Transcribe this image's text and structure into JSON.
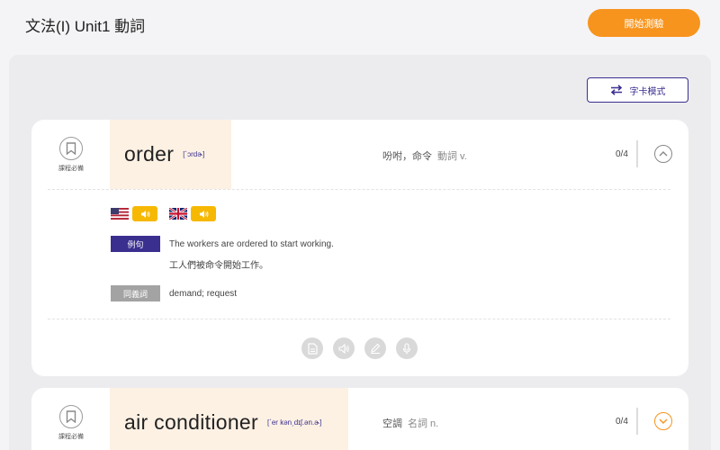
{
  "header": {
    "title": "文法(I) Unit1 動詞",
    "start_button": "開始測驗"
  },
  "toolbar": {
    "mode_button": "字卡模式"
  },
  "cards": [
    {
      "bookmark_label": "課程必備",
      "word": "order",
      "phonetic": "[ˋɔrdɚ]",
      "meaning": "吩咐，命令",
      "pos": "動詞 v.",
      "progress": "0/4",
      "example_tag": "例句",
      "example_en": "The workers are ordered to start working.",
      "example_zh": "工人們被命令開始工作。",
      "synonym_tag": "同義詞",
      "synonyms": "demand; request"
    },
    {
      "bookmark_label": "課程必備",
      "word": "air conditioner",
      "phonetic": "[ˋer kən͵dɪʃ.ən.ɚ]",
      "meaning": "空調",
      "pos": "名詞 n.",
      "progress": "0/4"
    }
  ],
  "colors": {
    "accent_orange": "#f7941d",
    "brand_purple": "#3a2f8f",
    "audio_yellow": "#f6b800"
  },
  "icons": [
    "swap-icon",
    "bookmark-icon",
    "us-flag-icon",
    "uk-flag-icon",
    "speaker-icon",
    "chevron-up-icon",
    "chevron-down-icon",
    "note-icon",
    "pencil-icon",
    "microphone-icon"
  ]
}
